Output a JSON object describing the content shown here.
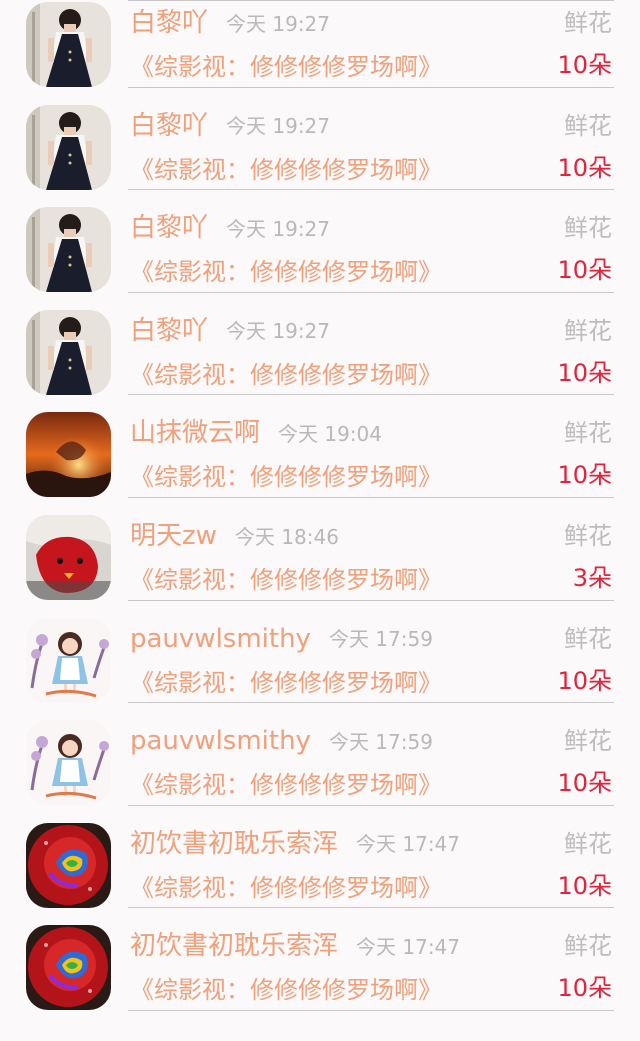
{
  "rows": [
    {
      "avatar": "girl-dress-avatar",
      "name": "白黎吖",
      "time": "今天 19:27",
      "gift": "鲜花",
      "book": "《综影视：修修修修罗场啊》",
      "count": "10朵"
    },
    {
      "avatar": "girl-dress-avatar",
      "name": "白黎吖",
      "time": "今天 19:27",
      "gift": "鲜花",
      "book": "《综影视：修修修修罗场啊》",
      "count": "10朵"
    },
    {
      "avatar": "girl-dress-avatar",
      "name": "白黎吖",
      "time": "今天 19:27",
      "gift": "鲜花",
      "book": "《综影视：修修修修罗场啊》",
      "count": "10朵"
    },
    {
      "avatar": "girl-dress-avatar",
      "name": "白黎吖",
      "time": "今天 19:27",
      "gift": "鲜花",
      "book": "《综影视：修修修修罗场啊》",
      "count": "10朵"
    },
    {
      "avatar": "sunset-avatar",
      "name": "山抹微云啊",
      "time": "今天 19:04",
      "gift": "鲜花",
      "book": "《综影视：修修修修罗场啊》",
      "count": "10朵"
    },
    {
      "avatar": "red-character-avatar",
      "name": "明天zw",
      "time": "今天 18:46",
      "gift": "鲜花",
      "book": "《综影视：修修修修罗场啊》",
      "count": "3朵"
    },
    {
      "avatar": "cartoon-girl-avatar",
      "name": "pauvwlsmithy",
      "time": "今天 17:59",
      "gift": "鲜花",
      "book": "《综影视：修修修修罗场啊》",
      "count": "10朵"
    },
    {
      "avatar": "cartoon-girl-avatar",
      "name": "pauvwlsmithy",
      "time": "今天 17:59",
      "gift": "鲜花",
      "book": "《综影视：修修修修罗场啊》",
      "count": "10朵"
    },
    {
      "avatar": "rainbow-rose-avatar",
      "name": "初饮書初耽乐索浑",
      "time": "今天 17:47",
      "gift": "鲜花",
      "book": "《综影视：修修修修罗场啊》",
      "count": "10朵"
    },
    {
      "avatar": "rainbow-rose-avatar",
      "name": "初饮書初耽乐索浑",
      "time": "今天 17:47",
      "gift": "鲜花",
      "book": "《综影视：修修修修罗场啊》",
      "count": "10朵"
    }
  ],
  "colors": {
    "name": "#f0a07a",
    "book": "#f0a07a",
    "time": "#b9b9b9",
    "gift": "#bdbdbd",
    "count": "#e0243c",
    "background": "#fbf9fa"
  }
}
